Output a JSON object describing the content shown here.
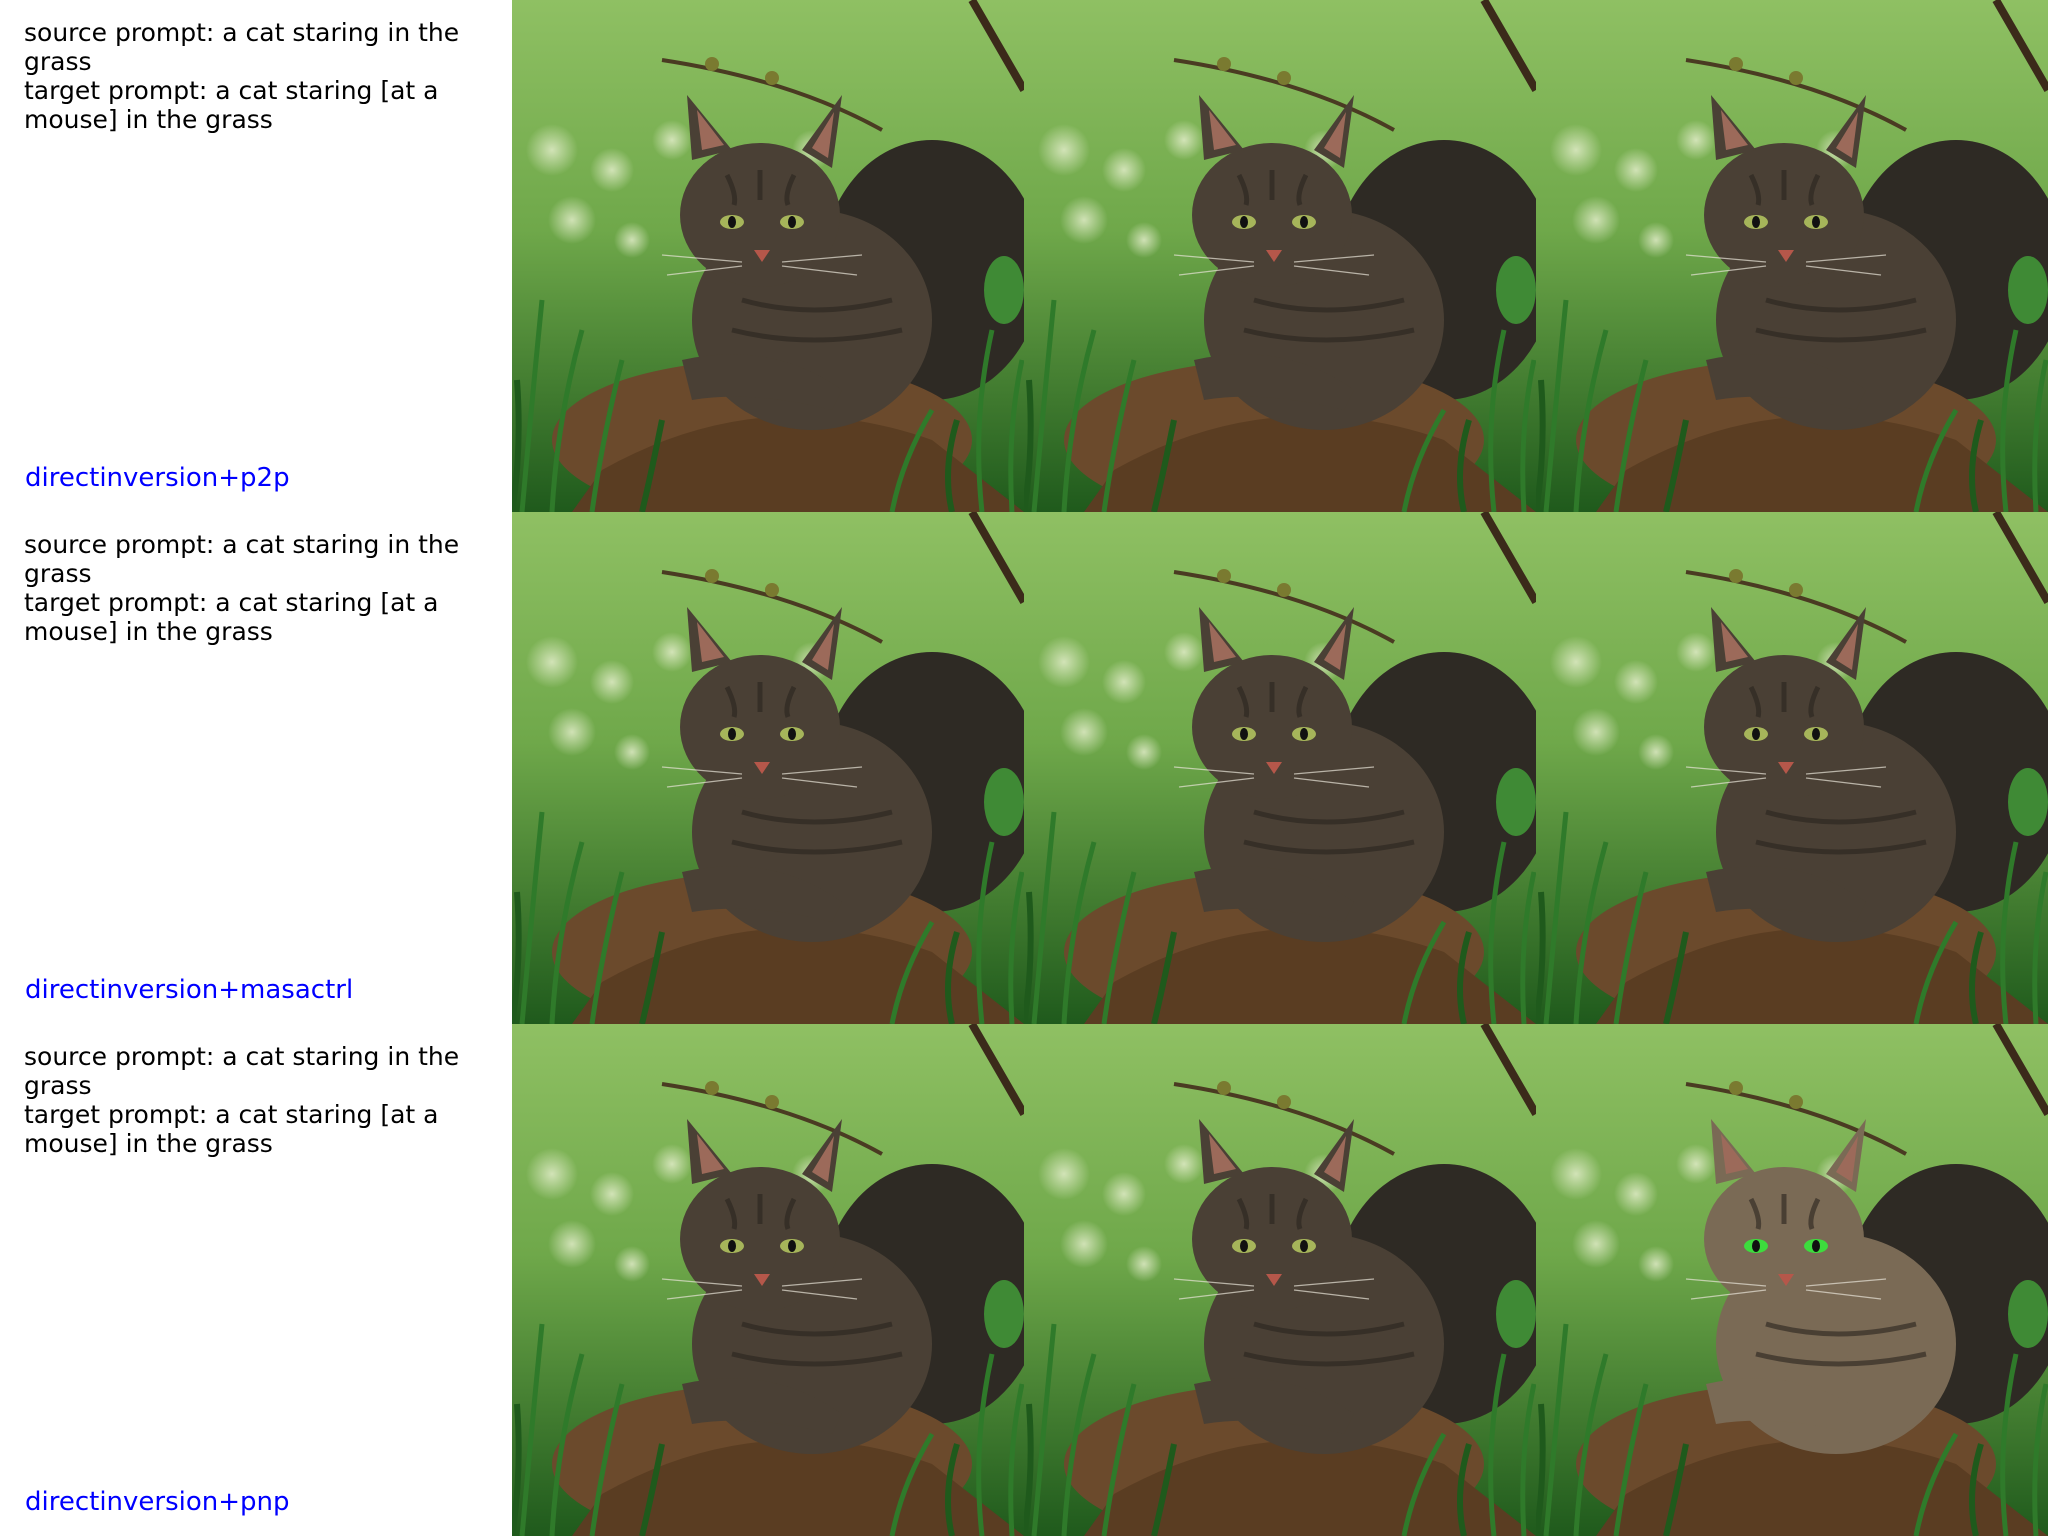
{
  "rows": [
    {
      "source_prompt": "source prompt: a cat staring in the grass",
      "target_prompt": "target prompt: a cat staring [at a mouse] in the grass",
      "method": "directinversion+p2p"
    },
    {
      "source_prompt": "source prompt: a cat staring in the grass",
      "target_prompt": "target prompt: a cat staring [at a mouse] in the grass",
      "method": "directinversion+masactrl"
    },
    {
      "source_prompt": "source prompt: a cat staring in the grass",
      "target_prompt": "target prompt: a cat staring [at a mouse] in the grass",
      "method": "directinversion+pnp"
    }
  ],
  "colors": {
    "method_label": "#0000ff",
    "prompt_text": "#000000",
    "grass_light": "#8fc063",
    "grass_dark": "#1f5a1c",
    "cat_fur": "#4a4035",
    "rock": "#6b4a2c"
  }
}
